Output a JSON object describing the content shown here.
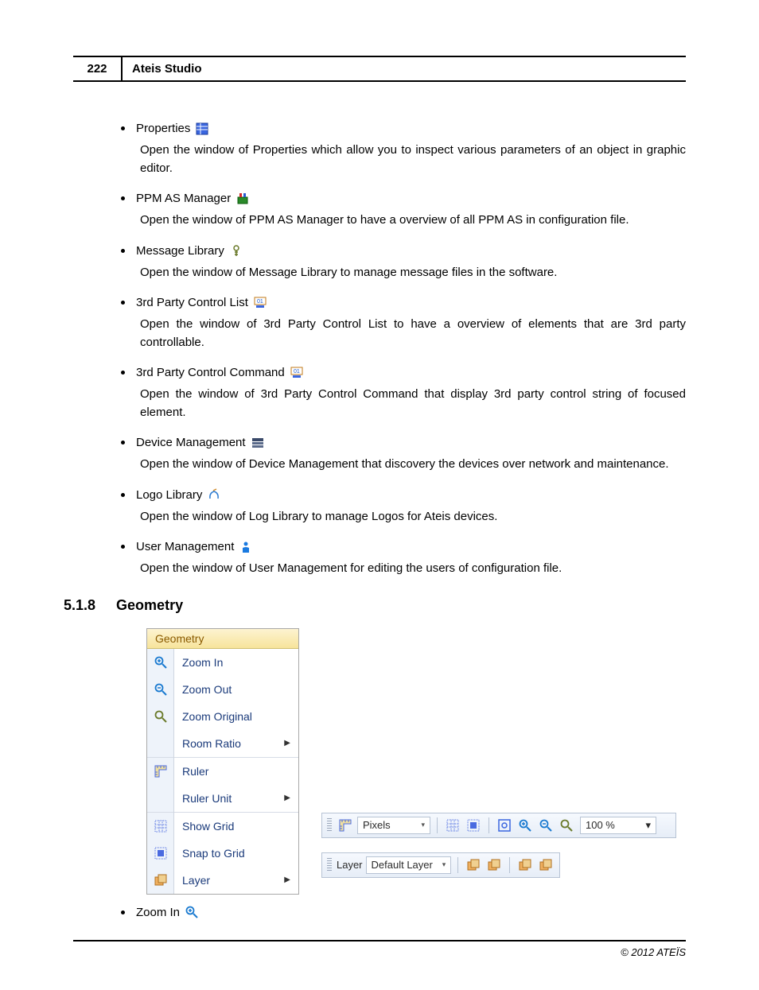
{
  "page_number": "222",
  "header_title": "Ateis Studio",
  "bullets": [
    {
      "label": "Properties",
      "icon": "properties-icon",
      "desc": "Open the window of Properties which allow you to inspect various parameters of an object in graphic editor."
    },
    {
      "label": "PPM AS Manager",
      "icon": "ppm-icon",
      "desc": "Open the window of PPM AS Manager to have a overview of all PPM AS in configuration file."
    },
    {
      "label": "Message Library",
      "icon": "message-icon",
      "desc": "Open the window of Message Library to manage message files in the software."
    },
    {
      "label": "3rd Party Control List",
      "icon": "third-party-list-icon",
      "desc": "Open the window of 3rd Party Control List to have a overview of elements that are 3rd party controllable."
    },
    {
      "label": "3rd Party Control Command",
      "icon": "third-party-cmd-icon",
      "desc": "Open the window of 3rd Party Control Command that display 3rd party control string of focused element."
    },
    {
      "label": "Device Management",
      "icon": "device-mgmt-icon",
      "desc": "Open the window of Device Management that discovery the devices over network and maintenance."
    },
    {
      "label": "Logo Library",
      "icon": "logo-library-icon",
      "desc": "Open the window of Log Library to manage Logos for Ateis devices."
    },
    {
      "label": "User Management",
      "icon": "user-mgmt-icon",
      "desc": "Open the window of User Management for editing the users of configuration file."
    }
  ],
  "section": {
    "number": "5.1.8",
    "title": "Geometry"
  },
  "geometry_menu": {
    "tab": "Geometry",
    "groups": [
      [
        {
          "icon": "zoom-in-icon",
          "label": "Zoom In",
          "sub": false
        },
        {
          "icon": "zoom-out-icon",
          "label": "Zoom Out",
          "sub": false
        },
        {
          "icon": "zoom-orig-icon",
          "label": "Zoom Original",
          "sub": false
        },
        {
          "icon": "",
          "label": "Room Ratio",
          "sub": true
        }
      ],
      [
        {
          "icon": "ruler-icon",
          "label": "Ruler",
          "sub": false
        },
        {
          "icon": "",
          "label": "Ruler Unit",
          "sub": true
        }
      ],
      [
        {
          "icon": "grid-icon",
          "label": "Show Grid",
          "sub": false
        },
        {
          "icon": "snap-icon",
          "label": "Snap to Grid",
          "sub": false
        },
        {
          "icon": "layer-icon",
          "label": "Layer",
          "sub": true
        }
      ]
    ]
  },
  "toolbar1": {
    "ruler_icon": "ruler-icon",
    "unit": "Pixels",
    "grid_icon": "grid-icon",
    "snap_icon": "snap-icon",
    "fit_icon": "zoom-fit-icon",
    "zin_icon": "zoom-in-icon",
    "zout_icon": "zoom-out-icon",
    "zorig_icon": "zoom-orig-icon",
    "zoom_value": "100 %"
  },
  "toolbar2": {
    "label": "Layer",
    "value": "Default Layer",
    "btn_add": "layer-add-icon",
    "btn_del": "layer-del-icon",
    "btn_up": "layer-copy-icon",
    "btn_dn": "layer-paste-icon"
  },
  "post_bullet": {
    "label": "Zoom In",
    "icon": "zoom-in-icon"
  },
  "footer": "© 2012 ATEÏS"
}
